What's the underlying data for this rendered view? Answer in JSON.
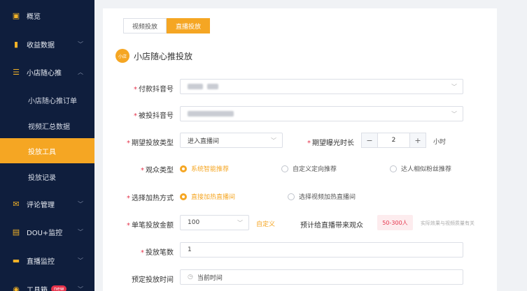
{
  "sidebar": {
    "items": [
      {
        "label": "概览",
        "icon": "chart-box-icon"
      },
      {
        "label": "收益数据",
        "icon": "bar-chart-icon"
      },
      {
        "label": "小店随心推",
        "icon": "store-icon"
      },
      {
        "label": "评论管理",
        "icon": "comment-icon"
      },
      {
        "label": "DOU+监控",
        "icon": "monitor-icon"
      },
      {
        "label": "直播监控",
        "icon": "live-icon"
      },
      {
        "label": "工具箱",
        "icon": "toolbox-icon",
        "badge": "new"
      }
    ],
    "sub_items": [
      {
        "label": "小店随心推订单"
      },
      {
        "label": "视频汇总数据"
      },
      {
        "label": "投放工具",
        "active": true
      },
      {
        "label": "投放记录"
      }
    ]
  },
  "tabs": [
    {
      "label": "视频投放"
    },
    {
      "label": "直播投放",
      "active": true
    }
  ],
  "section": {
    "title": "小店随心推投放",
    "logo_text": "小店"
  },
  "form": {
    "pay_account_label": "付款抖音号",
    "target_account_label": "被投抖音号",
    "goal_label": "期望投放类型",
    "goal_value": "进入直播间",
    "duration_label": "期望曝光时长",
    "duration_value": "2",
    "duration_unit": "小时",
    "audience_label": "观众类型",
    "audience_options": [
      "系统智能推荐",
      "自定义定向推荐",
      "达人相似粉丝推荐"
    ],
    "heat_label": "选择加热方式",
    "heat_options": [
      "直接加热直播间",
      "选择视频加热直播间"
    ],
    "amount_label": "单笔投放金额",
    "amount_value": "100",
    "custom_link": "自定义",
    "estimate_label": "预计给直播带来观众",
    "estimate_value": "50-300人",
    "estimate_note": "实际效果与视频质量有关",
    "count_label": "投放笔数",
    "count_value": "1",
    "time_label": "预定投放时间",
    "time_value": "当前时间"
  },
  "colors": {
    "accent": "#f5a623",
    "sidebar_bg": "#0f1e3d",
    "required": "#e5334b"
  }
}
